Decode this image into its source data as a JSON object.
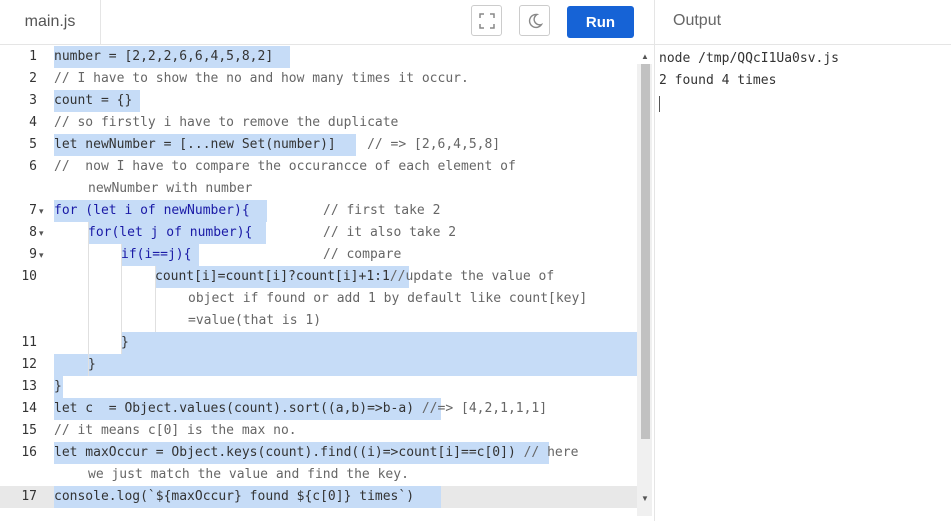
{
  "tab": {
    "filename": "main.js"
  },
  "toolbar": {
    "fullscreen_icon": "fullscreen-icon",
    "theme_icon": "moon-icon",
    "run_label": "Run",
    "accent": "#1663d6"
  },
  "output": {
    "title": "Output",
    "command": "node /tmp/QQcI1Ua0sv.js",
    "result": "2 found 4 times"
  },
  "editor": {
    "line_numbers": [
      "1",
      "2",
      "3",
      "4",
      "5",
      "6",
      "7",
      "8",
      "9",
      "10",
      "11",
      "12",
      "13",
      "14",
      "15",
      "16",
      "17"
    ],
    "lines": {
      "l1": "number = [2,2,2,6,6,4,5,8,2]",
      "l2": "// I have to show the no and how many times it occur.",
      "l3": "count = {}",
      "l4": "// so firstly i have to remove the duplicate",
      "l5_code": "let newNumber = [...new Set(number)]",
      "l5_comment": "// => [2,6,4,5,8]",
      "l6a": "//  now I have to compare the occurancce of each element of",
      "l6b": "newNumber with number",
      "l7_code": "for (let i of newNumber){",
      "l7_comment": "// first take 2",
      "l8_code": "for(let j of number){",
      "l8_comment": "// it also take 2",
      "l9_code": "if(i==j){",
      "l9_comment": "// compare",
      "l10_code": "count[i]=count[i]?count[i]+1:1",
      "l10_comment": "//update the value of",
      "l10b": "object if found or add 1 by default like count[key]",
      "l10c": "=value(that is 1)",
      "l11": "}",
      "l12": "}",
      "l13": "}",
      "l14_code": "let c  = Object.values(count).sort((a,b)=>b-a)",
      "l14_comment": "//=> [4,2,1,1,1]",
      "l15": "// it means c[0] is the max no.",
      "l16_code": "let maxOccur = Object.keys(count).find((i)=>count[i]==c[0])",
      "l16_comment": "// here",
      "l16b": "we just match the value and find the key.",
      "l17": "console.log(`${maxOccur} found ${c[0]} times`)"
    }
  }
}
